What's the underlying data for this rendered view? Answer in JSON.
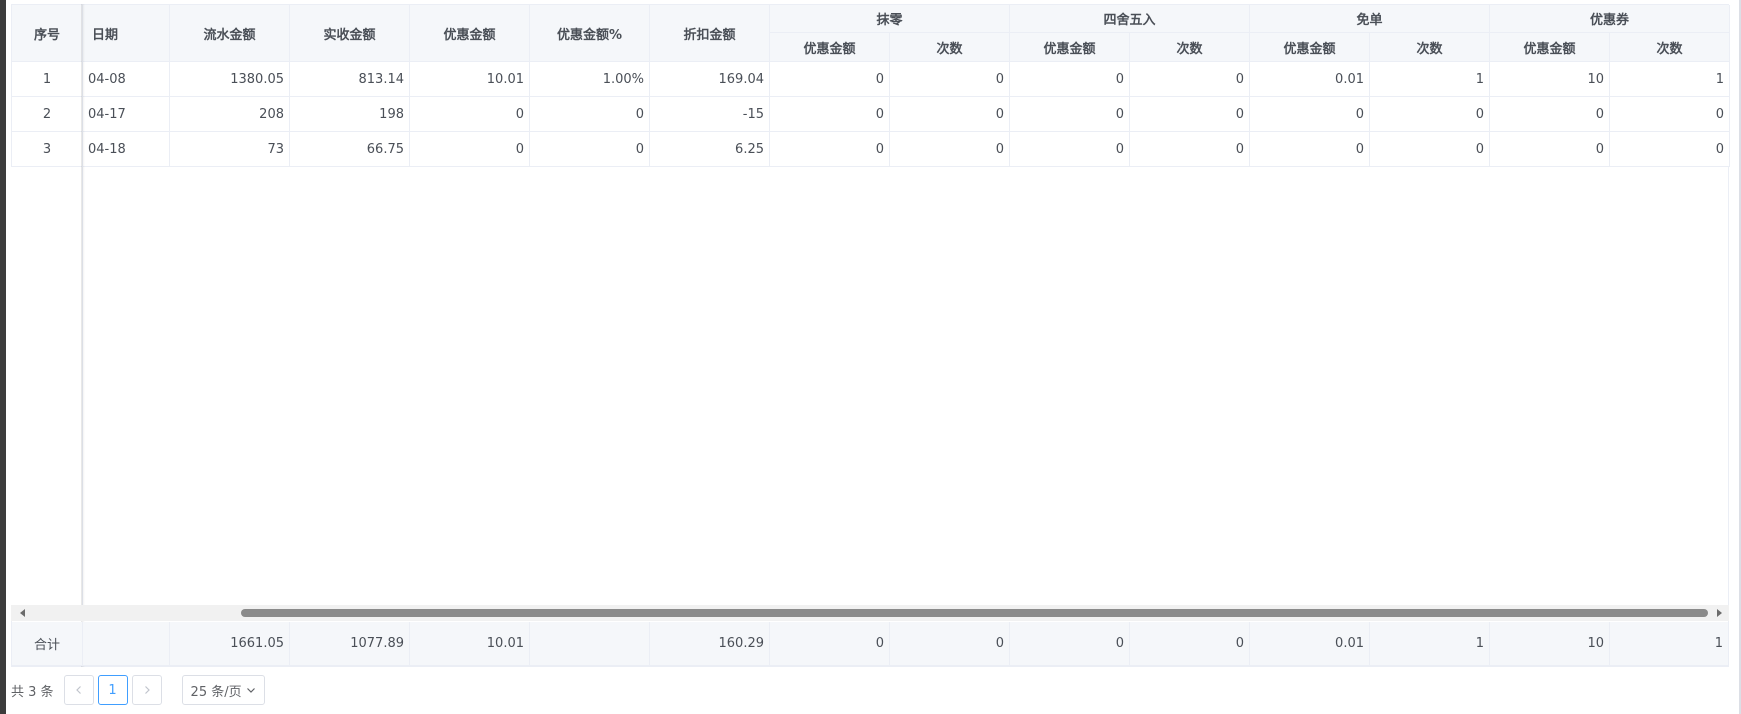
{
  "table": {
    "headers": {
      "index": "序号",
      "date": "日期",
      "flow_amount": "流水金额",
      "received_amount": "实收金额",
      "discount_amount": "优惠金额",
      "discount_pct": "优惠金额%",
      "deduct_amount": "折扣金额",
      "groups": [
        {
          "title": "抹零",
          "sub1": "优惠金额",
          "sub2": "次数"
        },
        {
          "title": "四舍五入",
          "sub1": "优惠金额",
          "sub2": "次数"
        },
        {
          "title": "免单",
          "sub1": "优惠金额",
          "sub2": "次数"
        },
        {
          "title": "优惠券",
          "sub1": "优惠金额",
          "sub2": "次数"
        }
      ]
    },
    "rows": [
      {
        "index": "1",
        "date": "04-08",
        "flow": "1380.05",
        "received": "813.14",
        "discount": "10.01",
        "pct": "1.00%",
        "deduct": "169.04",
        "g": [
          "0",
          "0",
          "0",
          "0",
          "0.01",
          "1",
          "10",
          "1"
        ]
      },
      {
        "index": "2",
        "date": "04-17",
        "flow": "208",
        "received": "198",
        "discount": "0",
        "pct": "0",
        "deduct": "-15",
        "g": [
          "0",
          "0",
          "0",
          "0",
          "0",
          "0",
          "0",
          "0"
        ]
      },
      {
        "index": "3",
        "date": "04-18",
        "flow": "73",
        "received": "66.75",
        "discount": "0",
        "pct": "0",
        "deduct": "6.25",
        "g": [
          "0",
          "0",
          "0",
          "0",
          "0",
          "0",
          "0",
          "0"
        ]
      }
    ],
    "summary": {
      "label": "合计",
      "date": "",
      "flow": "1661.05",
      "received": "1077.89",
      "discount": "10.01",
      "pct": "",
      "deduct": "160.29",
      "g": [
        "0",
        "0",
        "0",
        "0",
        "0.01",
        "1",
        "10",
        "1"
      ]
    }
  },
  "pagination": {
    "total_text": "共 3 条",
    "current_page": "1",
    "page_size_text": "25 条/页",
    "prev_icon": "chevron-left-icon",
    "next_icon": "chevron-right-icon"
  }
}
